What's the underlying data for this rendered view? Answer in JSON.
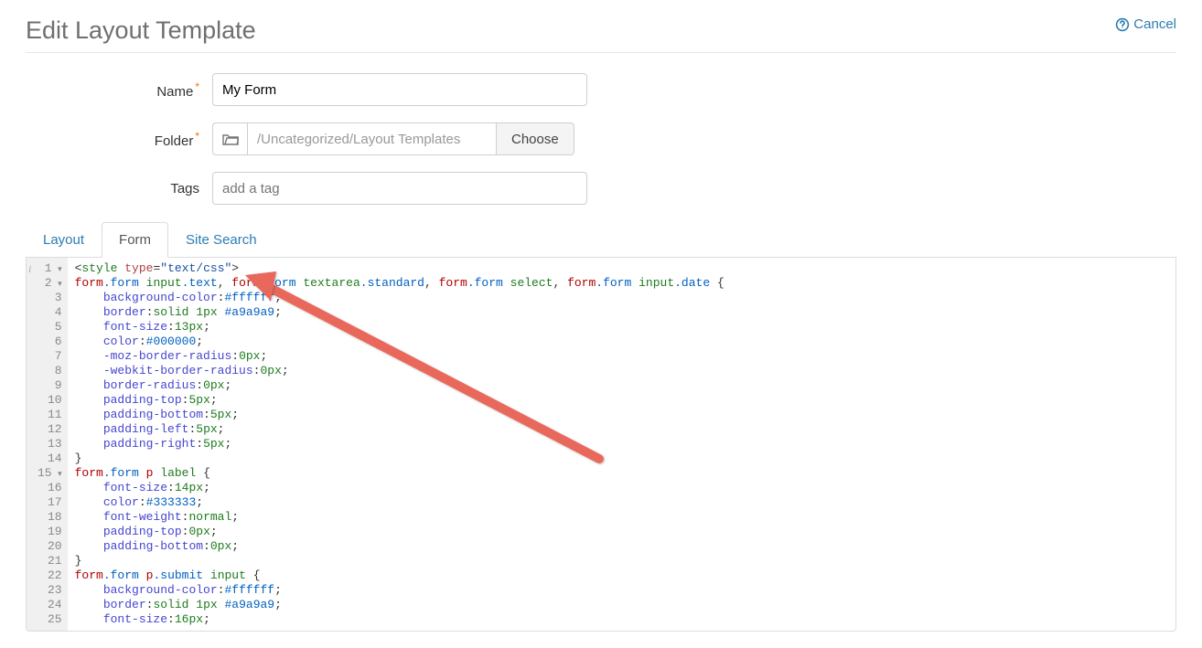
{
  "header": {
    "title": "Edit Layout Template",
    "cancel_label": "Cancel"
  },
  "fields": {
    "name_label": "Name",
    "name_value": "My Form",
    "folder_label": "Folder",
    "folder_path": "/Uncategorized/Layout Templates",
    "choose_label": "Choose",
    "tags_label": "Tags",
    "tags_placeholder": "add a tag"
  },
  "tabs": {
    "layout": "Layout",
    "form": "Form",
    "site_search": "Site Search",
    "active": "form"
  },
  "editor": {
    "lines": [
      {
        "n": 1,
        "fold": true,
        "tokens": [
          [
            "t-plain",
            "<"
          ],
          [
            "t-tag",
            "style"
          ],
          [
            "t-plain",
            " "
          ],
          [
            "t-attr",
            "type"
          ],
          [
            "t-plain",
            "="
          ],
          [
            "t-str",
            "\"text/css\""
          ],
          [
            "t-plain",
            ">"
          ]
        ]
      },
      {
        "n": 2,
        "fold": true,
        "tokens": [
          [
            "t-sel1",
            "form"
          ],
          [
            "t-cls",
            ".form"
          ],
          [
            "t-plain",
            " "
          ],
          [
            "t-sel2",
            "input"
          ],
          [
            "t-cls",
            ".text"
          ],
          [
            "t-plain",
            ", "
          ],
          [
            "t-sel1",
            "form"
          ],
          [
            "t-cls",
            ".form"
          ],
          [
            "t-plain",
            " "
          ],
          [
            "t-sel2",
            "textarea"
          ],
          [
            "t-cls",
            ".standard"
          ],
          [
            "t-plain",
            ", "
          ],
          [
            "t-sel1",
            "form"
          ],
          [
            "t-cls",
            ".form"
          ],
          [
            "t-plain",
            " "
          ],
          [
            "t-sel2",
            "select"
          ],
          [
            "t-plain",
            ", "
          ],
          [
            "t-sel1",
            "form"
          ],
          [
            "t-cls",
            ".form"
          ],
          [
            "t-plain",
            " "
          ],
          [
            "t-sel2",
            "input"
          ],
          [
            "t-cls",
            ".date"
          ],
          [
            "t-plain",
            " {"
          ]
        ]
      },
      {
        "n": 3,
        "tokens": [
          [
            "t-plain",
            "    "
          ],
          [
            "t-prop",
            "background-color"
          ],
          [
            "t-plain",
            ":"
          ],
          [
            "t-valb",
            "#ffffff"
          ],
          [
            "t-plain",
            ";"
          ]
        ]
      },
      {
        "n": 4,
        "tokens": [
          [
            "t-plain",
            "    "
          ],
          [
            "t-prop",
            "border"
          ],
          [
            "t-plain",
            ":"
          ],
          [
            "t-valg",
            "solid"
          ],
          [
            "t-plain",
            " "
          ],
          [
            "t-num",
            "1px"
          ],
          [
            "t-plain",
            " "
          ],
          [
            "t-valb",
            "#a9a9a9"
          ],
          [
            "t-plain",
            ";"
          ]
        ]
      },
      {
        "n": 5,
        "tokens": [
          [
            "t-plain",
            "    "
          ],
          [
            "t-prop",
            "font-size"
          ],
          [
            "t-plain",
            ":"
          ],
          [
            "t-num",
            "13px"
          ],
          [
            "t-plain",
            ";"
          ]
        ]
      },
      {
        "n": 6,
        "tokens": [
          [
            "t-plain",
            "    "
          ],
          [
            "t-prop",
            "color"
          ],
          [
            "t-plain",
            ":"
          ],
          [
            "t-valb",
            "#000000"
          ],
          [
            "t-plain",
            ";"
          ]
        ]
      },
      {
        "n": 7,
        "tokens": [
          [
            "t-plain",
            "    "
          ],
          [
            "t-prop",
            "-moz-border-radius"
          ],
          [
            "t-plain",
            ":"
          ],
          [
            "t-num",
            "0px"
          ],
          [
            "t-plain",
            ";"
          ]
        ]
      },
      {
        "n": 8,
        "tokens": [
          [
            "t-plain",
            "    "
          ],
          [
            "t-prop",
            "-webkit-border-radius"
          ],
          [
            "t-plain",
            ":"
          ],
          [
            "t-num",
            "0px"
          ],
          [
            "t-plain",
            ";"
          ]
        ]
      },
      {
        "n": 9,
        "tokens": [
          [
            "t-plain",
            "    "
          ],
          [
            "t-prop",
            "border-radius"
          ],
          [
            "t-plain",
            ":"
          ],
          [
            "t-num",
            "0px"
          ],
          [
            "t-plain",
            ";"
          ]
        ]
      },
      {
        "n": 10,
        "tokens": [
          [
            "t-plain",
            "    "
          ],
          [
            "t-prop",
            "padding-top"
          ],
          [
            "t-plain",
            ":"
          ],
          [
            "t-num",
            "5px"
          ],
          [
            "t-plain",
            ";"
          ]
        ]
      },
      {
        "n": 11,
        "tokens": [
          [
            "t-plain",
            "    "
          ],
          [
            "t-prop",
            "padding-bottom"
          ],
          [
            "t-plain",
            ":"
          ],
          [
            "t-num",
            "5px"
          ],
          [
            "t-plain",
            ";"
          ]
        ]
      },
      {
        "n": 12,
        "tokens": [
          [
            "t-plain",
            "    "
          ],
          [
            "t-prop",
            "padding-left"
          ],
          [
            "t-plain",
            ":"
          ],
          [
            "t-num",
            "5px"
          ],
          [
            "t-plain",
            ";"
          ]
        ]
      },
      {
        "n": 13,
        "tokens": [
          [
            "t-plain",
            "    "
          ],
          [
            "t-prop",
            "padding-right"
          ],
          [
            "t-plain",
            ":"
          ],
          [
            "t-num",
            "5px"
          ],
          [
            "t-plain",
            ";"
          ]
        ]
      },
      {
        "n": 14,
        "tokens": [
          [
            "t-plain",
            "}"
          ]
        ]
      },
      {
        "n": 15,
        "fold": true,
        "tokens": [
          [
            "t-sel1",
            "form"
          ],
          [
            "t-cls",
            ".form"
          ],
          [
            "t-plain",
            " "
          ],
          [
            "t-sel1",
            "p"
          ],
          [
            "t-plain",
            " "
          ],
          [
            "t-sel2",
            "label"
          ],
          [
            "t-plain",
            " {"
          ]
        ]
      },
      {
        "n": 16,
        "tokens": [
          [
            "t-plain",
            "    "
          ],
          [
            "t-prop",
            "font-size"
          ],
          [
            "t-plain",
            ":"
          ],
          [
            "t-num",
            "14px"
          ],
          [
            "t-plain",
            ";"
          ]
        ]
      },
      {
        "n": 17,
        "tokens": [
          [
            "t-plain",
            "    "
          ],
          [
            "t-prop",
            "color"
          ],
          [
            "t-plain",
            ":"
          ],
          [
            "t-valb",
            "#333333"
          ],
          [
            "t-plain",
            ";"
          ]
        ]
      },
      {
        "n": 18,
        "tokens": [
          [
            "t-plain",
            "    "
          ],
          [
            "t-prop",
            "font-weight"
          ],
          [
            "t-plain",
            ":"
          ],
          [
            "t-valg",
            "normal"
          ],
          [
            "t-plain",
            ";"
          ]
        ]
      },
      {
        "n": 19,
        "tokens": [
          [
            "t-plain",
            "    "
          ],
          [
            "t-prop",
            "padding-top"
          ],
          [
            "t-plain",
            ":"
          ],
          [
            "t-num",
            "0px"
          ],
          [
            "t-plain",
            ";"
          ]
        ]
      },
      {
        "n": 20,
        "tokens": [
          [
            "t-plain",
            "    "
          ],
          [
            "t-prop",
            "padding-bottom"
          ],
          [
            "t-plain",
            ":"
          ],
          [
            "t-num",
            "0px"
          ],
          [
            "t-plain",
            ";"
          ]
        ]
      },
      {
        "n": 21,
        "tokens": [
          [
            "t-plain",
            "}"
          ]
        ]
      },
      {
        "n": 22,
        "tokens": [
          [
            "t-sel1",
            "form"
          ],
          [
            "t-cls",
            ".form"
          ],
          [
            "t-plain",
            " "
          ],
          [
            "t-sel1",
            "p"
          ],
          [
            "t-cls",
            ".submit"
          ],
          [
            "t-plain",
            " "
          ],
          [
            "t-sel2",
            "input"
          ],
          [
            "t-plain",
            " {"
          ]
        ]
      },
      {
        "n": 23,
        "tokens": [
          [
            "t-plain",
            "    "
          ],
          [
            "t-prop",
            "background-color"
          ],
          [
            "t-plain",
            ":"
          ],
          [
            "t-valb",
            "#ffffff"
          ],
          [
            "t-plain",
            ";"
          ]
        ]
      },
      {
        "n": 24,
        "tokens": [
          [
            "t-plain",
            "    "
          ],
          [
            "t-prop",
            "border"
          ],
          [
            "t-plain",
            ":"
          ],
          [
            "t-valg",
            "solid"
          ],
          [
            "t-plain",
            " "
          ],
          [
            "t-num",
            "1px"
          ],
          [
            "t-plain",
            " "
          ],
          [
            "t-valb",
            "#a9a9a9"
          ],
          [
            "t-plain",
            ";"
          ]
        ]
      },
      {
        "n": 25,
        "tokens": [
          [
            "t-plain",
            "    "
          ],
          [
            "t-prop",
            "font-size"
          ],
          [
            "t-plain",
            ":"
          ],
          [
            "t-num",
            "16px"
          ],
          [
            "t-plain",
            ";"
          ]
        ]
      }
    ]
  }
}
